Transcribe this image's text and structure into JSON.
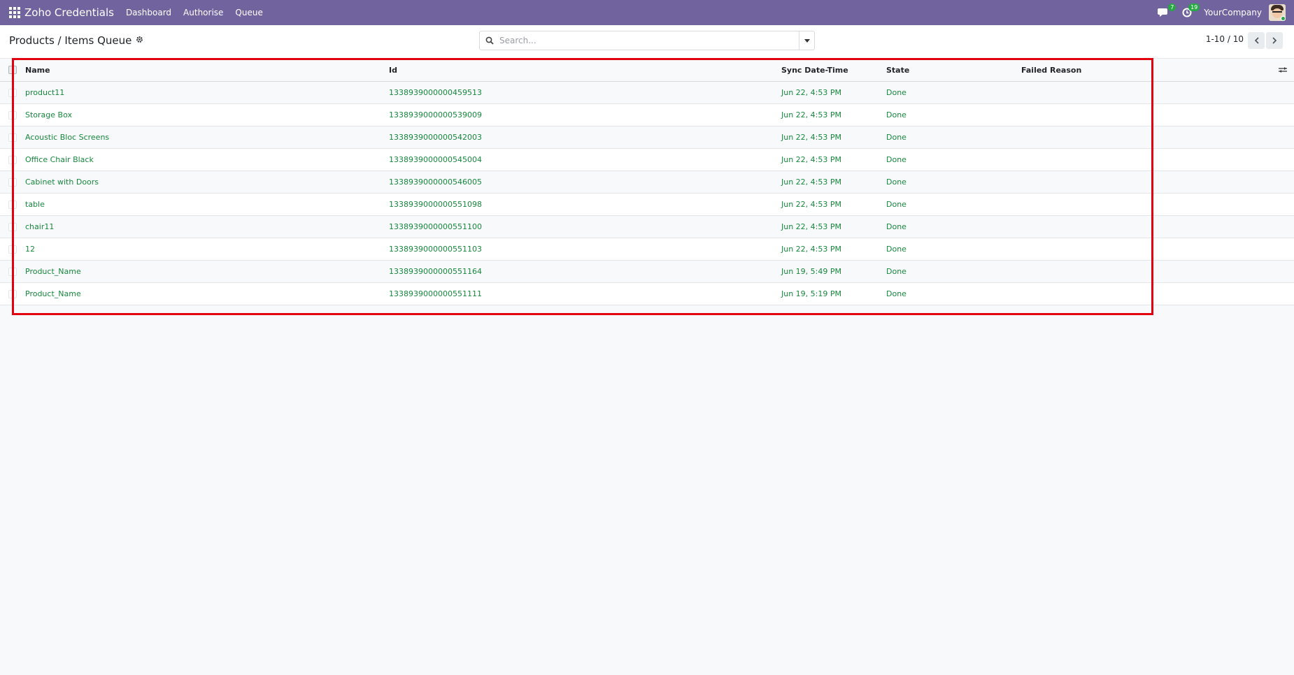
{
  "navbar": {
    "app_title": "Zoho Credentials",
    "menu": [
      {
        "label": "Dashboard"
      },
      {
        "label": "Authorise"
      },
      {
        "label": "Queue"
      }
    ],
    "messages_count": "7",
    "activities_count": "19",
    "company": "YourCompany",
    "bg_color": "#71639e"
  },
  "control": {
    "breadcrumb": "Products / Items Queue",
    "search_placeholder": "Search...",
    "pager": "1-10 / 10"
  },
  "table": {
    "headers": {
      "name": "Name",
      "id": "Id",
      "sync": "Sync Date-Time",
      "state": "State",
      "failed": "Failed Reason"
    },
    "rows": [
      {
        "name": "product11",
        "id": "1338939000000459513",
        "sync": "Jun 22, 4:53 PM",
        "state": "Done",
        "failed": ""
      },
      {
        "name": "Storage Box",
        "id": "1338939000000539009",
        "sync": "Jun 22, 4:53 PM",
        "state": "Done",
        "failed": ""
      },
      {
        "name": "Acoustic Bloc Screens",
        "id": "1338939000000542003",
        "sync": "Jun 22, 4:53 PM",
        "state": "Done",
        "failed": ""
      },
      {
        "name": "Office Chair Black",
        "id": "1338939000000545004",
        "sync": "Jun 22, 4:53 PM",
        "state": "Done",
        "failed": ""
      },
      {
        "name": "Cabinet with Doors",
        "id": "1338939000000546005",
        "sync": "Jun 22, 4:53 PM",
        "state": "Done",
        "failed": ""
      },
      {
        "name": "table",
        "id": "1338939000000551098",
        "sync": "Jun 22, 4:53 PM",
        "state": "Done",
        "failed": ""
      },
      {
        "name": "chair11",
        "id": "1338939000000551100",
        "sync": "Jun 22, 4:53 PM",
        "state": "Done",
        "failed": ""
      },
      {
        "name": "12",
        "id": "1338939000000551103",
        "sync": "Jun 22, 4:53 PM",
        "state": "Done",
        "failed": ""
      },
      {
        "name": "Product_Name",
        "id": "1338939000000551164",
        "sync": "Jun 19, 5:49 PM",
        "state": "Done",
        "failed": ""
      },
      {
        "name": "Product_Name",
        "id": "1338939000000551111",
        "sync": "Jun 19, 5:19 PM",
        "state": "Done",
        "failed": ""
      }
    ],
    "row_text_color": "#17883e"
  },
  "highlight_color": "#e3000f"
}
